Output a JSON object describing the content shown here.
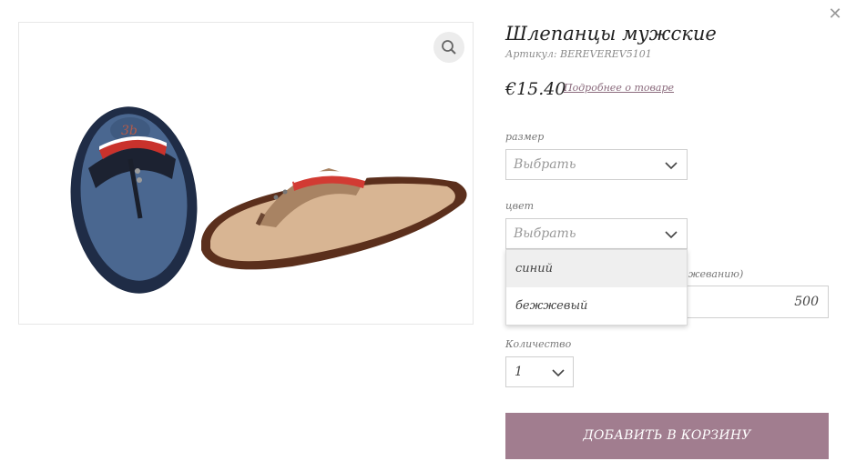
{
  "product": {
    "title": "Шлепанцы мужские",
    "sku": "Артикул: BEREVEREV5101",
    "price": "€15.40",
    "details_link": "Подробнее о товаре"
  },
  "options": {
    "size": {
      "label": "размер",
      "value": "Выбрать"
    },
    "color": {
      "label": "цвет",
      "value": "Выбрать",
      "dropdown": [
        "синий",
        "бежжевый"
      ],
      "highlighted": "синий"
    },
    "partial_field": {
      "label": "жеванию)",
      "value": "500"
    },
    "quantity": {
      "label": "Количество",
      "value": "1"
    }
  },
  "actions": {
    "add_to_cart": "ДОБАВИТЬ В КОРЗИНУ"
  },
  "icons": {
    "close": "close-icon",
    "zoom": "magnifier-icon"
  },
  "colors": {
    "accent": "#a17d8f",
    "link": "#8a6a7c",
    "sandal_blue": "#4a6790",
    "sandal_tan": "#b48c6e"
  }
}
